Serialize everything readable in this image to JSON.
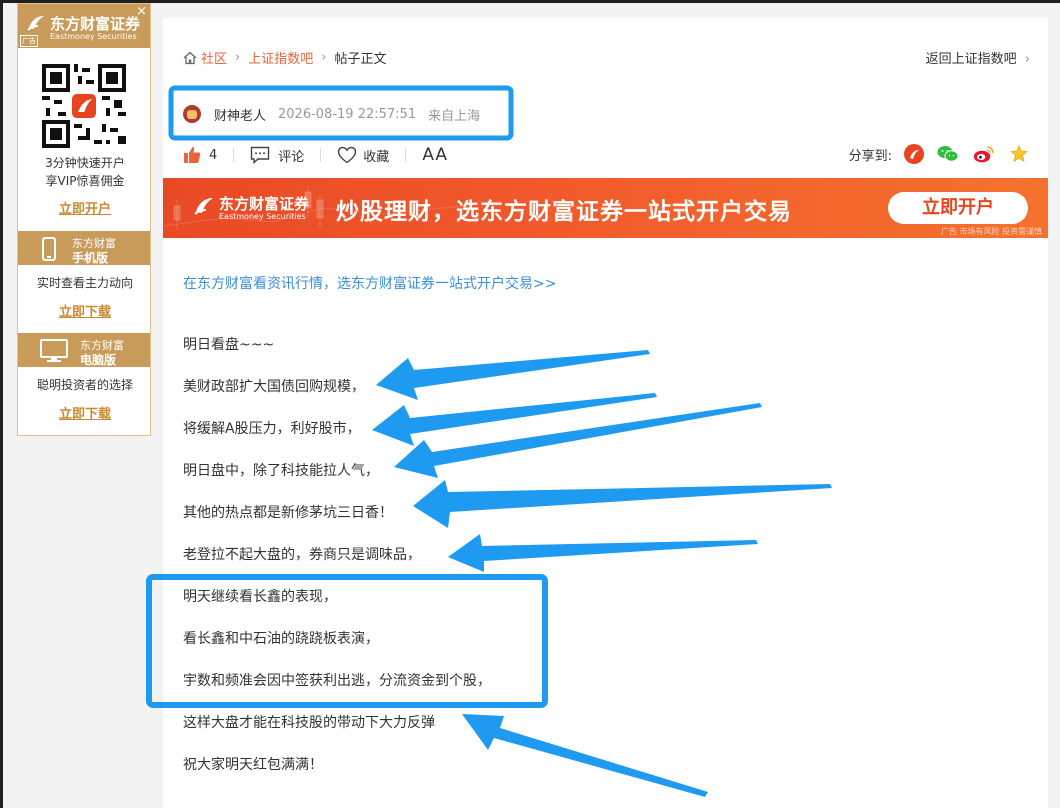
{
  "ad_left": {
    "brand_cn": "东方财富证券",
    "brand_en": "Eastmoney Securities",
    "ad_tag": "广告",
    "close": "×",
    "line1": "3分钟快速开户",
    "line2": "享VIP惊喜佣金",
    "cta1": "立即开户",
    "mobile_t1": "东方财富",
    "mobile_t2": "手机版",
    "mobile_desc": "实时查看主力动向",
    "cta2": "立即下载",
    "pc_t1": "东方财富",
    "pc_t2": "电脑版",
    "pc_desc": "聪明投资者的选择",
    "cta3": "立即下载",
    "brand_color": "#c99b5a",
    "link_color": "#c98a2f"
  },
  "breadcrumb": {
    "home": "社区",
    "forum": "上证指数吧",
    "current": "帖子正文"
  },
  "back_link": "返回上证指数吧",
  "author": {
    "name": "财神老人",
    "time": "2026-08-19 22:57:51",
    "from": "来自上海"
  },
  "actions": {
    "likes": "4",
    "comment": "评论",
    "favorite": "收藏",
    "font": "AA"
  },
  "share": {
    "label": "分享到:"
  },
  "banner": {
    "brand": "东方财富证券",
    "brand_en": "Eastmoney Securities",
    "slogan": "炒股理财，选东方财富证券一站式开户交易",
    "button": "立即开户",
    "tag": "广告 市场有风险 投资需谨慎"
  },
  "promo_link": "在东方财富看资讯行情，选东方财富证券一站式开户交易>>",
  "post_lines": [
    "明日看盘~~~",
    "美财政部扩大国债回购规模，",
    "将缓解A股压力，利好股市，",
    "明日盘中，除了科技能拉人气，",
    "其他的热点都是新修茅坑三日香！",
    "老登拉不起大盘的，券商只是调味品，",
    "明天继续看长鑫的表现，",
    "看长鑫和中石油的跷跷板表演，",
    "宇数和频准会因中签获利出逃，分流资金到个股，",
    "这样大盘才能在科技股的带动下大力反弹",
    "祝大家明天红包满满！"
  ],
  "colors": {
    "accent": "#e8643c",
    "link_blue": "#3b8ed8",
    "annotation_blue": "#1e9bf0"
  }
}
